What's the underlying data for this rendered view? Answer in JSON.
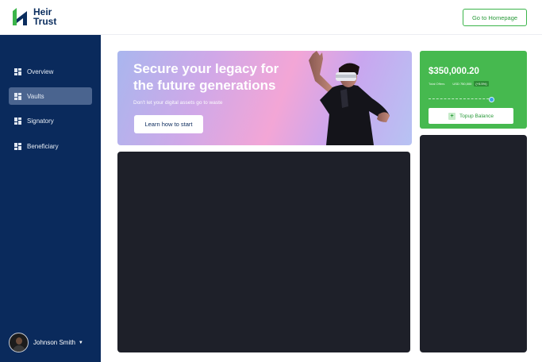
{
  "header": {
    "logo_line1": "Heir",
    "logo_line2": "Trust",
    "homepage_button": "Go to Homepage"
  },
  "sidebar": {
    "items": [
      {
        "label": "Overview",
        "active": false
      },
      {
        "label": "Vaults",
        "active": true
      },
      {
        "label": "Signatory",
        "active": false
      },
      {
        "label": "Beneficiary",
        "active": false
      }
    ],
    "user_name": "Johnson Smith"
  },
  "hero": {
    "title": "Secure your legacy for the future generations",
    "subtitle": "Don't let your digital assets go to waste",
    "cta": "Learn how to start"
  },
  "balance": {
    "amount": "$350,000.20",
    "label": "Total Offers",
    "value": "USD 750,000",
    "percent": "(+5.5%)",
    "topup_label": "Topup Balance"
  },
  "colors": {
    "sidebar": "#0a2a5c",
    "accent_green": "#46b94f",
    "panel_dark": "#1e2029"
  }
}
